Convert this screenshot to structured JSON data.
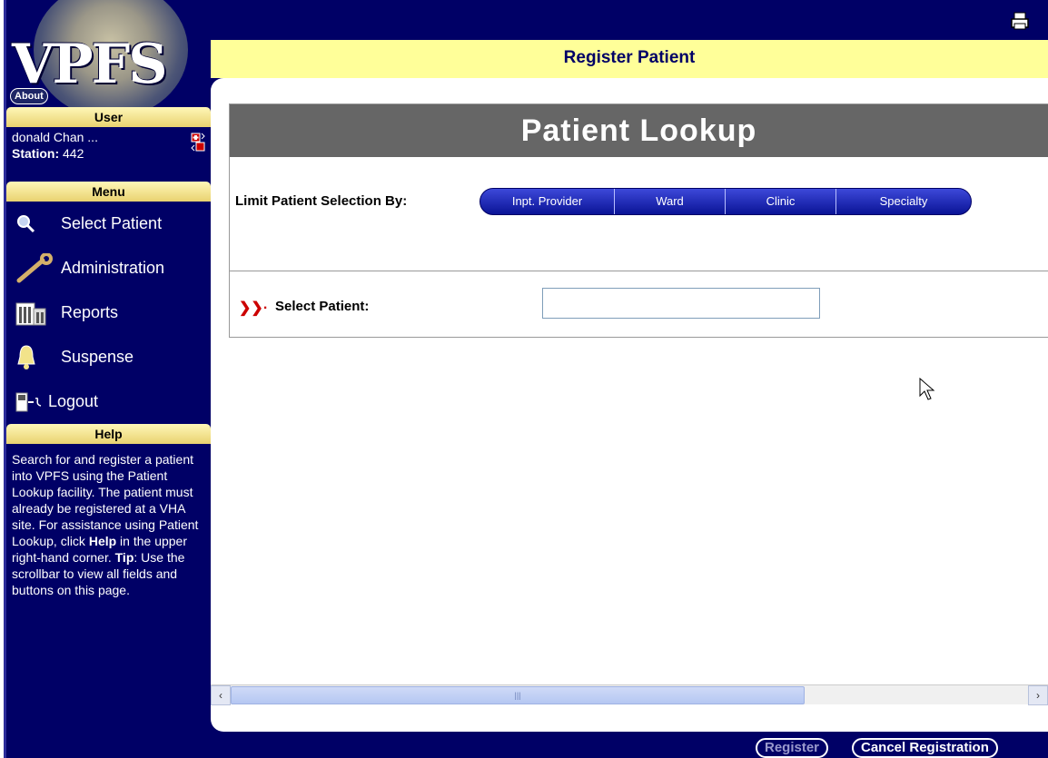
{
  "app": {
    "logo_text": "VPFS",
    "about_label": "About"
  },
  "user": {
    "heading": "User",
    "name": "donald Chan ...",
    "station_label": "Station:",
    "station_value": "442"
  },
  "menu": {
    "heading": "Menu",
    "items": [
      {
        "label": "Select Patient",
        "icon": "magnifier-icon"
      },
      {
        "label": "Administration",
        "icon": "wrench-icon"
      },
      {
        "label": "Reports",
        "icon": "reports-icon"
      },
      {
        "label": "Suspense",
        "icon": "bell-icon"
      },
      {
        "label": "Logout",
        "icon": "logout-icon"
      }
    ]
  },
  "help": {
    "heading": "Help",
    "text_1": "Search for and register a patient into VPFS using the Patient Lookup facility. The patient must already be registered at a VHA site. For assistance using Patient Lookup, click ",
    "help_word": "Help",
    "text_2": " in the upper right-hand corner.",
    "tip_word": "Tip",
    "text_3": ": Use the scrollbar to view all fields and buttons on this page."
  },
  "page": {
    "title": "Register Patient"
  },
  "lookup": {
    "title": "Patient Lookup",
    "limit_label": "Limit Patient Selection By:",
    "limit_buttons": [
      "Inpt. Provider",
      "Ward",
      "Clinic",
      "Specialty"
    ],
    "select_label": "Select Patient:",
    "select_value": ""
  },
  "footer": {
    "register_label": "Register",
    "cancel_label": "Cancel Registration"
  },
  "colors": {
    "navy": "#000066",
    "header_yellow": "#ffff99",
    "pill_blue": "#0a1396",
    "lookup_gray": "#666666"
  }
}
